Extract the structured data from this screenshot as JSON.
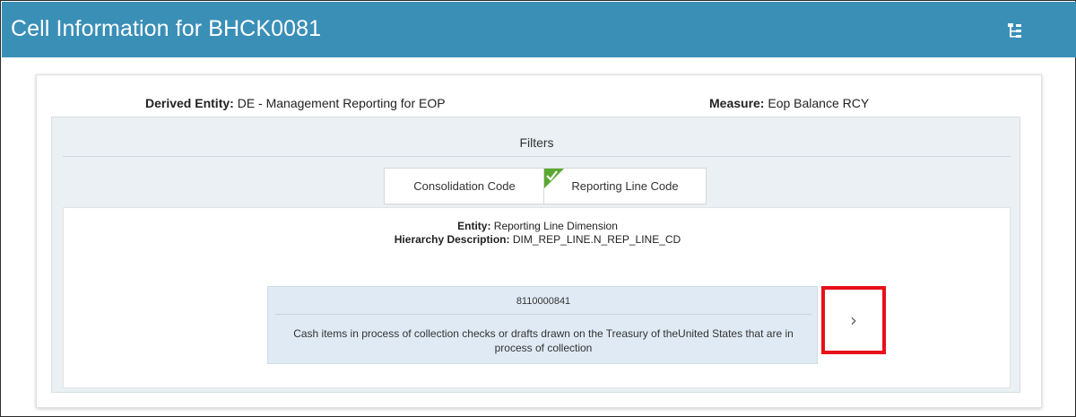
{
  "header": {
    "title": "Cell Information for BHCK0081",
    "icon": "hierarchy-tree-icon"
  },
  "card": {
    "derived_entity_label": "Derived Entity:",
    "derived_entity_value": " DE - Management Reporting for EOP",
    "measure_label": "Measure:",
    "measure_value": " Eop Balance RCY"
  },
  "filters": {
    "title": "Filters",
    "tabs": [
      {
        "label": "Consolidation Code",
        "selected": false
      },
      {
        "label": "Reporting Line Code",
        "selected": true
      }
    ]
  },
  "detail": {
    "entity_label": "Entity:",
    "entity_value": " Reporting Line Dimension",
    "hierarchy_label": "Hierarchy Description:",
    "hierarchy_value": " DIM_REP_LINE.N_REP_LINE_CD",
    "node": {
      "code": "8110000841",
      "description": "Cash items in process of collection checks or drafts drawn on the Treasury of theUnited States that are in process of collection"
    },
    "expand_icon": "chevron-right-icon"
  },
  "colors": {
    "header_bg": "#3a8fb7",
    "panel_bg": "#eaf0f4",
    "node_bg": "#dfeaf4",
    "highlight": "#e8101a",
    "check_green": "#5aa832"
  }
}
